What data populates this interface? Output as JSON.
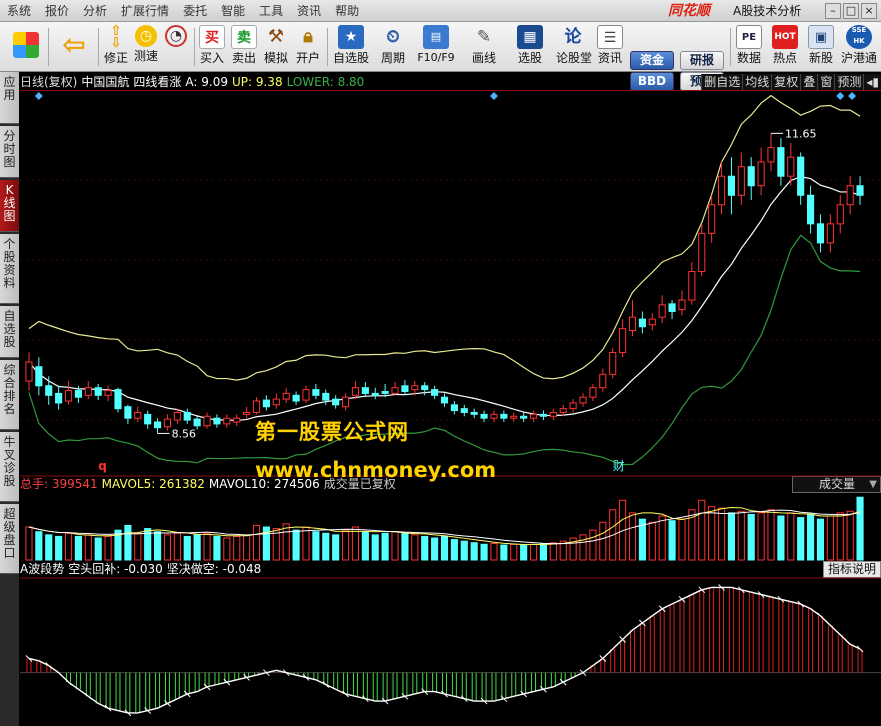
{
  "menubar": {
    "items": [
      "系统",
      "报价",
      "分析",
      "扩展行情",
      "委托",
      "智能",
      "工具",
      "资讯",
      "帮助"
    ],
    "brand": "同花顺",
    "title": "A股技术分析"
  },
  "toolbar": {
    "buttons": [
      {
        "label": "修正",
        "icon": "up-down-arrows-icon"
      },
      {
        "label": "测速",
        "icon": "stopwatch-icon"
      },
      {
        "label": "买入",
        "icon": "buy-icon",
        "glyph": "买"
      },
      {
        "label": "卖出",
        "icon": "sell-icon",
        "glyph": "卖"
      },
      {
        "label": "模拟",
        "icon": "gavel-icon"
      },
      {
        "label": "开户",
        "icon": "lock-icon"
      },
      {
        "label": "自选股",
        "icon": "star-icon"
      },
      {
        "label": "周期",
        "icon": "clock-icon"
      },
      {
        "label": "F10/F9",
        "icon": "f10-icon"
      },
      {
        "label": "画线",
        "icon": "pencil-icon"
      },
      {
        "label": "选股",
        "icon": "monitor-icon"
      },
      {
        "label": "论股堂",
        "icon": "lun-icon",
        "glyph": "论"
      },
      {
        "label": "资讯",
        "icon": "document-icon"
      },
      {
        "label": "数据",
        "icon": "pe-icon",
        "glyph": "PE"
      },
      {
        "label": "热点",
        "icon": "hot-icon",
        "glyph": "HOT"
      },
      {
        "label": "新股",
        "icon": "new-stock-icon"
      },
      {
        "label": "沪港通",
        "icon": "sse-hk-icon",
        "glyph": "SSE HK"
      }
    ],
    "pills": [
      "资金",
      "BBD",
      "研报",
      "预测"
    ]
  },
  "left_tabs": [
    "应用",
    "分时图",
    "K线图",
    "个股资料",
    "自选股",
    "综合排名",
    "牛叉诊股",
    "超级盘口"
  ],
  "active_tab": "K线图",
  "price_strip": {
    "mode": "日线(复权)",
    "stock": "中国国航",
    "indicator": "四线看涨",
    "a_label": "A: 9.09",
    "up_label": "UP: 9.38",
    "lower_label": "LOWER: 8.80"
  },
  "right_buttons": [
    "删自选",
    "均线",
    "复权",
    "叠",
    "窗",
    "预测"
  ],
  "volume_strip": {
    "total_hand": "总手: 399541",
    "mavol5": "MAVOL5: 261382",
    "mavol10": "MAVOL10: 274506",
    "note": "成交量已复权"
  },
  "volume_selector": "成交量",
  "indicator_strip": {
    "name": "A波段势",
    "bear_cover": "空头回补: -0.030",
    "firm_short": "坚决做空: -0.048"
  },
  "explain_button": "指标说明",
  "chart_annotations": {
    "high": "11.65",
    "low": "8.56",
    "marker_q": "q",
    "marker_finance": "财"
  },
  "watermark": {
    "line1": "第一股票公式网",
    "line2": "www.chnmoney.com"
  },
  "colors": {
    "up": "#ff3232",
    "down": "#54ffff",
    "upper_band": "#e8e890",
    "middle_band": "#ffffff",
    "lower_band": "#2f9a3a",
    "watermark": "#ffd200",
    "hist_up": "#e02020",
    "hist_down": "#44dd44"
  },
  "chart_data": {
    "type": "candlestick",
    "price_range": [
      8.2,
      12.0
    ],
    "candles": [
      [
        9.05,
        9.25,
        8.95,
        9.35
      ],
      [
        9.2,
        9.0,
        8.9,
        9.3
      ],
      [
        9.0,
        8.9,
        8.8,
        9.1
      ],
      [
        8.92,
        8.82,
        8.75,
        9.0
      ],
      [
        8.84,
        8.95,
        8.8,
        9.05
      ],
      [
        8.95,
        8.88,
        8.82,
        9.0
      ],
      [
        8.9,
        8.98,
        8.86,
        9.05
      ],
      [
        8.98,
        8.9,
        8.85,
        9.02
      ],
      [
        8.9,
        8.95,
        8.84,
        9.0
      ],
      [
        8.96,
        8.76,
        8.72,
        8.98
      ],
      [
        8.78,
        8.66,
        8.6,
        8.8
      ],
      [
        8.66,
        8.72,
        8.62,
        8.78
      ],
      [
        8.7,
        8.6,
        8.55,
        8.74
      ],
      [
        8.62,
        8.56,
        8.5,
        8.66
      ],
      [
        8.57,
        8.65,
        8.53,
        8.7
      ],
      [
        8.64,
        8.72,
        8.6,
        8.76
      ],
      [
        8.72,
        8.64,
        8.6,
        8.76
      ],
      [
        8.65,
        8.58,
        8.54,
        8.68
      ],
      [
        8.58,
        8.68,
        8.55,
        8.72
      ],
      [
        8.66,
        8.6,
        8.56,
        8.7
      ],
      [
        8.6,
        8.66,
        8.56,
        8.7
      ],
      [
        8.62,
        8.66,
        8.58,
        8.7
      ],
      [
        8.7,
        8.72,
        8.66,
        8.78
      ],
      [
        8.72,
        8.84,
        8.7,
        8.88
      ],
      [
        8.85,
        8.78,
        8.74,
        8.9
      ],
      [
        8.8,
        8.86,
        8.76,
        8.92
      ],
      [
        8.86,
        8.92,
        8.82,
        8.98
      ],
      [
        8.9,
        8.84,
        8.8,
        8.94
      ],
      [
        8.85,
        8.96,
        8.82,
        9.0
      ],
      [
        8.96,
        8.9,
        8.86,
        9.02
      ],
      [
        8.92,
        8.85,
        8.8,
        8.96
      ],
      [
        8.86,
        8.8,
        8.76,
        8.9
      ],
      [
        8.78,
        8.88,
        8.74,
        8.92
      ],
      [
        8.9,
        8.98,
        8.86,
        9.05
      ],
      [
        8.98,
        8.92,
        8.88,
        9.04
      ],
      [
        8.92,
        8.9,
        8.86,
        8.98
      ],
      [
        8.94,
        8.92,
        8.88,
        9.02
      ],
      [
        8.92,
        8.98,
        8.9,
        9.04
      ],
      [
        9.0,
        8.94,
        8.9,
        9.06
      ],
      [
        8.96,
        9.0,
        8.9,
        9.05
      ],
      [
        9.0,
        8.96,
        8.9,
        9.04
      ],
      [
        8.96,
        8.9,
        8.86,
        9.0
      ],
      [
        8.88,
        8.82,
        8.78,
        8.92
      ],
      [
        8.8,
        8.74,
        8.7,
        8.84
      ],
      [
        8.76,
        8.72,
        8.68,
        8.8
      ],
      [
        8.72,
        8.7,
        8.66,
        8.76
      ],
      [
        8.7,
        8.66,
        8.62,
        8.74
      ],
      [
        8.66,
        8.7,
        8.62,
        8.74
      ],
      [
        8.7,
        8.66,
        8.62,
        8.74
      ],
      [
        8.66,
        8.68,
        8.62,
        8.72
      ],
      [
        8.68,
        8.66,
        8.62,
        8.72
      ],
      [
        8.66,
        8.7,
        8.62,
        8.74
      ],
      [
        8.7,
        8.68,
        8.64,
        8.74
      ],
      [
        8.68,
        8.72,
        8.64,
        8.76
      ],
      [
        8.72,
        8.76,
        8.68,
        8.8
      ],
      [
        8.76,
        8.82,
        8.72,
        8.86
      ],
      [
        8.82,
        8.88,
        8.78,
        8.92
      ],
      [
        8.88,
        8.98,
        8.84,
        9.02
      ],
      [
        8.98,
        9.12,
        8.94,
        9.18
      ],
      [
        9.12,
        9.35,
        9.08,
        9.4
      ],
      [
        9.35,
        9.6,
        9.3,
        9.7
      ],
      [
        9.58,
        9.72,
        9.52,
        9.9
      ],
      [
        9.7,
        9.62,
        9.55,
        9.78
      ],
      [
        9.64,
        9.7,
        9.58,
        9.76
      ],
      [
        9.72,
        9.85,
        9.66,
        9.95
      ],
      [
        9.86,
        9.78,
        9.7,
        9.9
      ],
      [
        9.8,
        9.9,
        9.74,
        10.0
      ],
      [
        9.9,
        10.2,
        9.85,
        10.3
      ],
      [
        10.2,
        10.6,
        10.15,
        10.7
      ],
      [
        10.6,
        10.9,
        10.5,
        11.0
      ],
      [
        10.9,
        11.2,
        10.8,
        11.35
      ],
      [
        11.2,
        11.0,
        10.8,
        11.4
      ],
      [
        11.0,
        11.3,
        10.9,
        11.45
      ],
      [
        11.3,
        11.1,
        10.95,
        11.4
      ],
      [
        11.1,
        11.35,
        11.0,
        11.5
      ],
      [
        11.35,
        11.5,
        11.25,
        11.65
      ],
      [
        11.5,
        11.2,
        11.1,
        11.6
      ],
      [
        11.2,
        11.4,
        11.1,
        11.55
      ],
      [
        11.4,
        11.0,
        10.9,
        11.45
      ],
      [
        11.0,
        10.7,
        10.6,
        11.1
      ],
      [
        10.7,
        10.5,
        10.4,
        10.8
      ],
      [
        10.5,
        10.7,
        10.4,
        10.8
      ],
      [
        10.7,
        10.9,
        10.6,
        11.0
      ],
      [
        10.9,
        11.1,
        10.8,
        11.2
      ],
      [
        11.1,
        11.0,
        10.9,
        11.2
      ]
    ],
    "volume": [
      210,
      180,
      160,
      150,
      170,
      150,
      160,
      140,
      150,
      190,
      220,
      170,
      200,
      180,
      160,
      170,
      150,
      160,
      170,
      150,
      140,
      150,
      160,
      220,
      210,
      200,
      230,
      190,
      210,
      180,
      170,
      160,
      190,
      210,
      180,
      160,
      170,
      180,
      170,
      160,
      150,
      140,
      150,
      130,
      120,
      110,
      100,
      105,
      95,
      100,
      95,
      100,
      105,
      110,
      120,
      140,
      160,
      190,
      240,
      320,
      380,
      300,
      260,
      240,
      280,
      250,
      260,
      320,
      380,
      340,
      330,
      300,
      310,
      290,
      300,
      320,
      280,
      300,
      270,
      290,
      260,
      280,
      300,
      310,
      399.541
    ],
    "volume_max": 420,
    "macd": [
      0.06,
      0.05,
      0.03,
      0.0,
      -0.04,
      -0.07,
      -0.1,
      -0.13,
      -0.15,
      -0.16,
      -0.17,
      -0.17,
      -0.16,
      -0.15,
      -0.13,
      -0.11,
      -0.09,
      -0.08,
      -0.06,
      -0.05,
      -0.04,
      -0.03,
      -0.02,
      -0.01,
      0.0,
      0.01,
      0.0,
      -0.01,
      -0.02,
      -0.03,
      -0.05,
      -0.07,
      -0.09,
      -0.1,
      -0.11,
      -0.12,
      -0.12,
      -0.11,
      -0.1,
      -0.09,
      -0.08,
      -0.08,
      -0.09,
      -0.1,
      -0.11,
      -0.12,
      -0.12,
      -0.12,
      -0.11,
      -0.1,
      -0.09,
      -0.08,
      -0.07,
      -0.06,
      -0.04,
      -0.02,
      0.0,
      0.03,
      0.06,
      0.1,
      0.14,
      0.18,
      0.21,
      0.24,
      0.27,
      0.29,
      0.31,
      0.33,
      0.35,
      0.36,
      0.36,
      0.36,
      0.35,
      0.34,
      0.33,
      0.32,
      0.31,
      0.3,
      0.29,
      0.27,
      0.24,
      0.2,
      0.16,
      0.12,
      0.1
    ],
    "macd_range": [
      -0.2,
      0.4
    ]
  }
}
